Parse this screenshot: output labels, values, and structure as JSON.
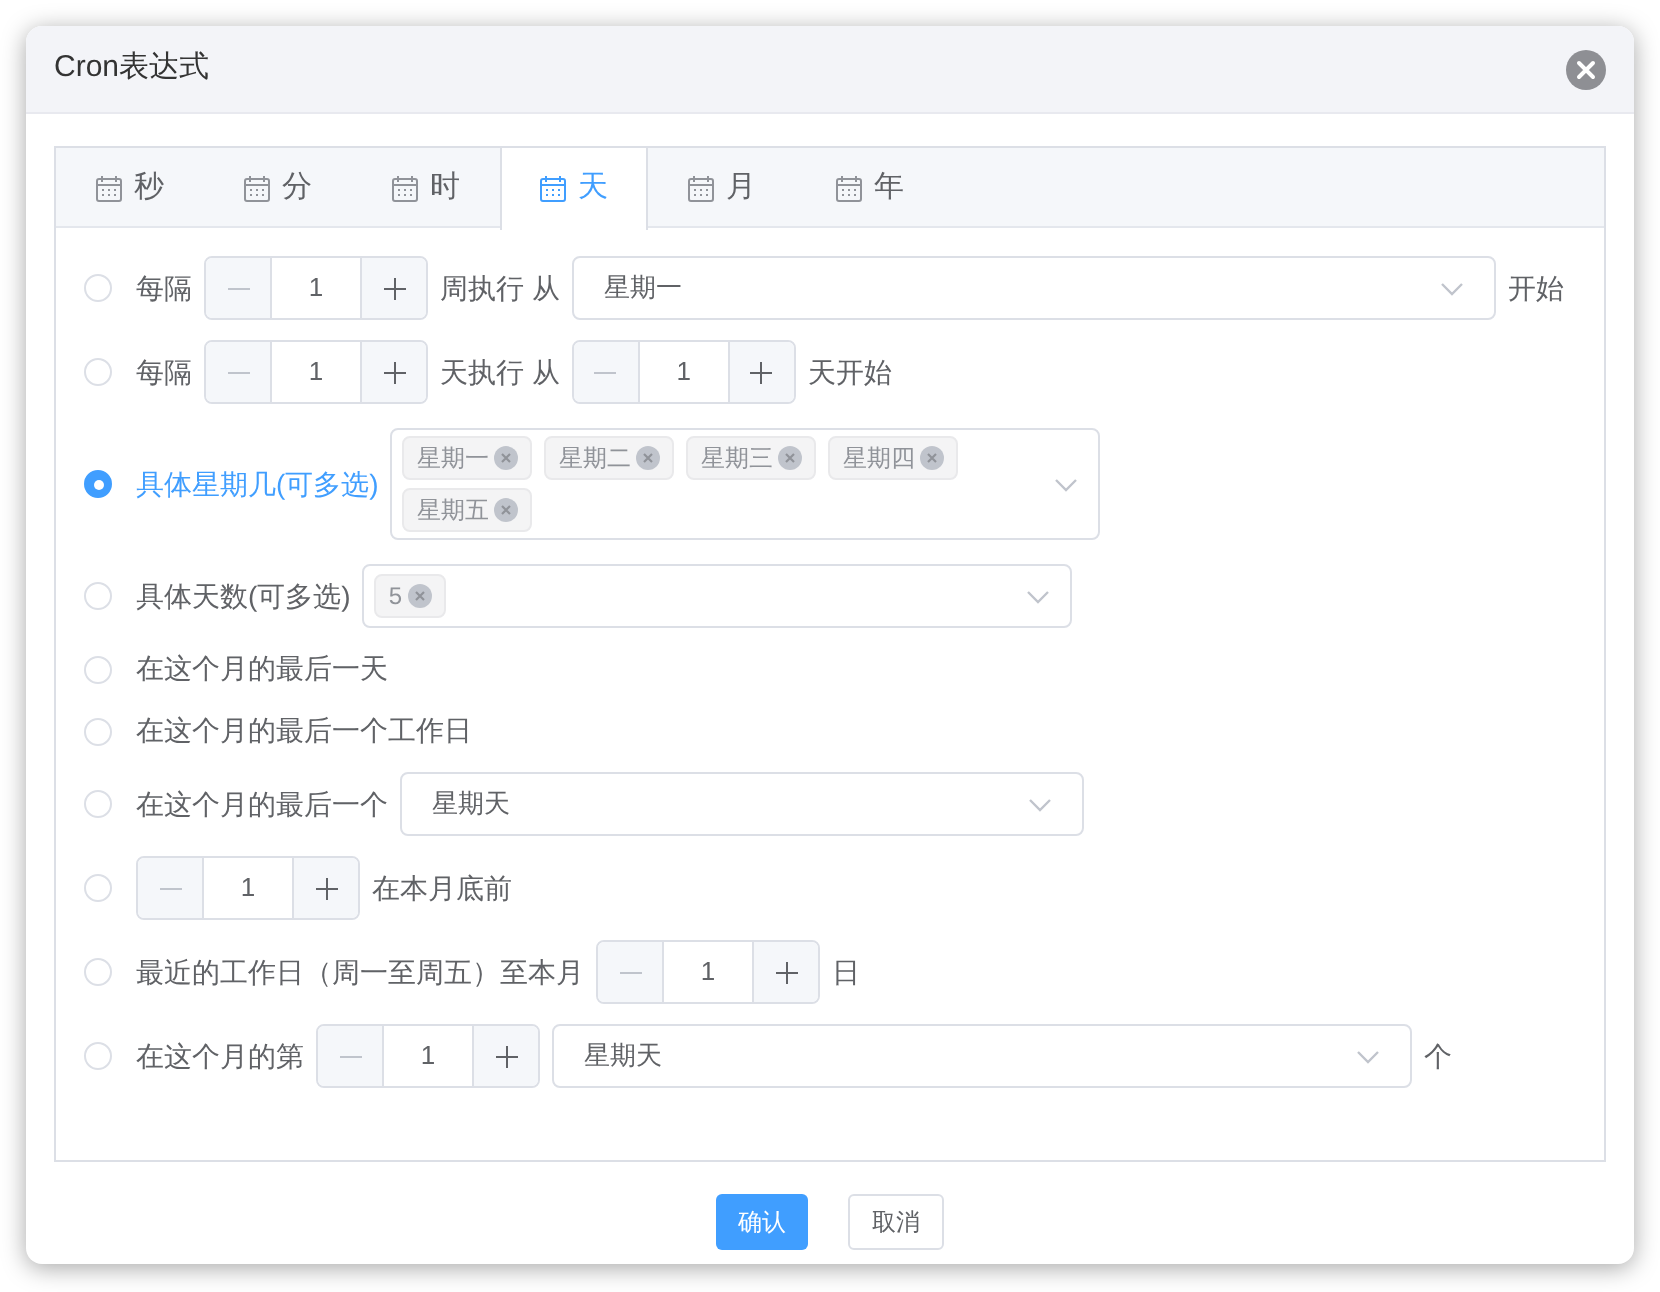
{
  "dialog": {
    "title": "Cron表达式"
  },
  "tabs": [
    {
      "label": "秒",
      "selected": false
    },
    {
      "label": "分",
      "selected": false
    },
    {
      "label": "时",
      "selected": false
    },
    {
      "label": "天",
      "selected": true
    },
    {
      "label": "月",
      "selected": false
    },
    {
      "label": "年",
      "selected": false
    }
  ],
  "options": [
    {
      "selected": false,
      "parts": [
        {
          "kind": "text",
          "text": "每隔"
        },
        {
          "kind": "number",
          "value": "1"
        },
        {
          "kind": "text",
          "text": "周执行 从"
        },
        {
          "kind": "select",
          "value": "星期一"
        },
        {
          "kind": "text",
          "text": "开始"
        }
      ]
    },
    {
      "selected": false,
      "parts": [
        {
          "kind": "text",
          "text": "每隔"
        },
        {
          "kind": "number",
          "value": "1"
        },
        {
          "kind": "text",
          "text": "天执行 从"
        },
        {
          "kind": "number",
          "value": "1"
        },
        {
          "kind": "text",
          "text": "天开始"
        }
      ]
    },
    {
      "selected": true,
      "parts": [
        {
          "kind": "text",
          "text": "具体星期几(可多选)"
        },
        {
          "kind": "multiselect",
          "tags": [
            "星期一",
            "星期二",
            "星期三",
            "星期四",
            "星期五"
          ]
        }
      ]
    },
    {
      "selected": false,
      "parts": [
        {
          "kind": "text",
          "text": "具体天数(可多选)"
        },
        {
          "kind": "multiselect",
          "tags": [
            "5"
          ]
        }
      ]
    },
    {
      "selected": false,
      "parts": [
        {
          "kind": "text",
          "text": "在这个月的最后一天"
        }
      ]
    },
    {
      "selected": false,
      "parts": [
        {
          "kind": "text",
          "text": "在这个月的最后一个工作日"
        }
      ]
    },
    {
      "selected": false,
      "parts": [
        {
          "kind": "text",
          "text": "在这个月的最后一个"
        },
        {
          "kind": "select",
          "value": "星期天"
        }
      ]
    },
    {
      "selected": false,
      "parts": [
        {
          "kind": "number",
          "value": "1"
        },
        {
          "kind": "text",
          "text": "在本月底前"
        }
      ]
    },
    {
      "selected": false,
      "parts": [
        {
          "kind": "text",
          "text": "最近的工作日（周一至周五）至本月"
        },
        {
          "kind": "number",
          "value": "1"
        },
        {
          "kind": "text",
          "text": "日"
        }
      ]
    },
    {
      "selected": false,
      "parts": [
        {
          "kind": "text",
          "text": "在这个月的第"
        },
        {
          "kind": "number",
          "value": "1"
        },
        {
          "kind": "select",
          "value": "星期天"
        },
        {
          "kind": "text",
          "text": "个"
        }
      ]
    }
  ],
  "buttons": [
    {
      "label": "确认",
      "kind": "primary"
    },
    {
      "label": "取消",
      "kind": "default"
    }
  ]
}
